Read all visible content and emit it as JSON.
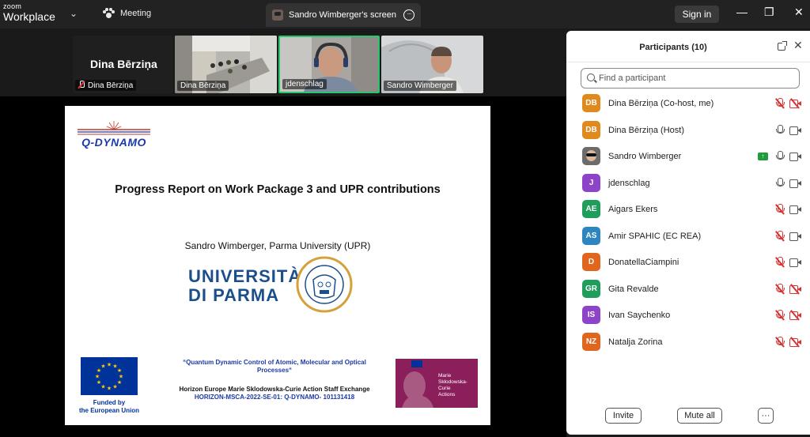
{
  "app": {
    "brand_small": "zoom",
    "brand_large": "Workplace"
  },
  "titlebar": {
    "meeting_label": "Meeting",
    "screen_tab_label": "Sandro Wimberger's screen",
    "signin_label": "Sign in",
    "minimize_glyph": "—",
    "restore_glyph": "❐",
    "close_glyph": "✕"
  },
  "video_strip": {
    "tiles": [
      {
        "name": "Dina Bērziņa",
        "display_name": "Dina Bērziņa",
        "muted": true
      },
      {
        "name": "Dina Bērziņa"
      },
      {
        "name": "jdenschlag",
        "active_speaker": true
      },
      {
        "name": "Sandro Wimberger"
      }
    ]
  },
  "slide": {
    "logo_text": "Q-DYNAMO",
    "title": "Progress Report on Work Package 3 and UPR contributions",
    "author": "Sandro Wimberger, Parma University (UPR)",
    "university_line1": "UNIVERSITÀ",
    "university_line2": "DI PARMA",
    "funded_line1": "Funded by",
    "funded_line2": "the European Union",
    "project_quote": "“Quantum Dynamic Control of Atomic, Molecular and Optical Processes“",
    "horizon_line1": "Horizon Europe Marie Sklodowska-Curie Action Staff Exchange",
    "horizon_line2": "HORIZON-MSCA-2022-SE-01: Q-DYNAMO- 101131418",
    "msca_line1": "Marie",
    "msca_line2": "Skłodowska-Curie",
    "msca_line3": "Actions"
  },
  "participants": {
    "title": "Participants (10)",
    "search_placeholder": "Find a participant",
    "list": [
      {
        "initials": "DB",
        "name": "Dina Bērziņa (Co-host, me)",
        "color": "#e08a1e",
        "mic_muted": true,
        "cam_off": true
      },
      {
        "initials": "DB",
        "name": "Dina Bērziņa (Host)",
        "color": "#e08a1e",
        "mic_muted": false,
        "cam_off": false
      },
      {
        "initials": "",
        "name": "Sandro Wimberger",
        "color": "#6c6c6c",
        "photo": true,
        "sharing": true,
        "mic_muted": false,
        "cam_off": false
      },
      {
        "initials": "J",
        "name": "jdenschlag",
        "color": "#8e44c9",
        "mic_muted": false,
        "cam_off": false
      },
      {
        "initials": "AE",
        "name": "Aigars Ekers",
        "color": "#1e9e5a",
        "mic_muted": true,
        "cam_off": false
      },
      {
        "initials": "AS",
        "name": "Amir SPAHIC (EC REA)",
        "color": "#2e86c1",
        "mic_muted": true,
        "cam_off": false
      },
      {
        "initials": "D",
        "name": "DonatellaCiampini",
        "color": "#e0661e",
        "mic_muted": true,
        "cam_off": false
      },
      {
        "initials": "GR",
        "name": "Gita Revalde",
        "color": "#1e9e5a",
        "mic_muted": true,
        "cam_off": true
      },
      {
        "initials": "IS",
        "name": "Ivan Saychenko",
        "color": "#8e44c9",
        "mic_muted": true,
        "cam_off": true
      },
      {
        "initials": "NZ",
        "name": "Natalja Zorina",
        "color": "#e0661e",
        "mic_muted": true,
        "cam_off": true
      }
    ],
    "invite_label": "Invite",
    "mute_all_label": "Mute all",
    "more_label": "···"
  }
}
